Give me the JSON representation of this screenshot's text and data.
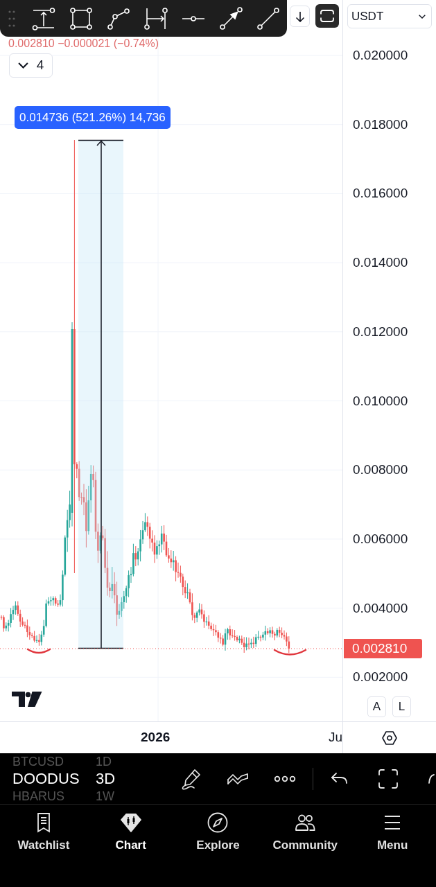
{
  "legend": "0.002810 −0.000021 (−0.74%)",
  "collapse_button": {
    "label": "4"
  },
  "toggles": [
    {
      "selected": false
    },
    {
      "selected": true
    }
  ],
  "currency_select": {
    "value": "USDT"
  },
  "measure_label": "0.014736 (521.26%) 14,736",
  "price_axis": {
    "labels": [
      "0.020000",
      "0.018000",
      "0.016000",
      "0.014000",
      "0.012000",
      "0.010000",
      "0.008000",
      "0.006000",
      "0.004000",
      "0.002000"
    ],
    "current_price": "0.002810"
  },
  "scale_buttons": [
    "A",
    "L"
  ],
  "time_axis": [
    "2026",
    "Ju"
  ],
  "symbols": [
    {
      "symbol": "BTCUSD",
      "interval": "1D",
      "selected": false
    },
    {
      "symbol": "DOODUS",
      "interval": "3D",
      "selected": true
    },
    {
      "symbol": "HBARUS",
      "interval": "1W",
      "selected": false
    }
  ],
  "nav": [
    {
      "label": "Watchlist",
      "selected": false
    },
    {
      "label": "Chart",
      "selected": true
    },
    {
      "label": "Explore",
      "selected": false
    },
    {
      "label": "Community",
      "selected": false
    },
    {
      "label": "Menu",
      "selected": false
    }
  ]
}
